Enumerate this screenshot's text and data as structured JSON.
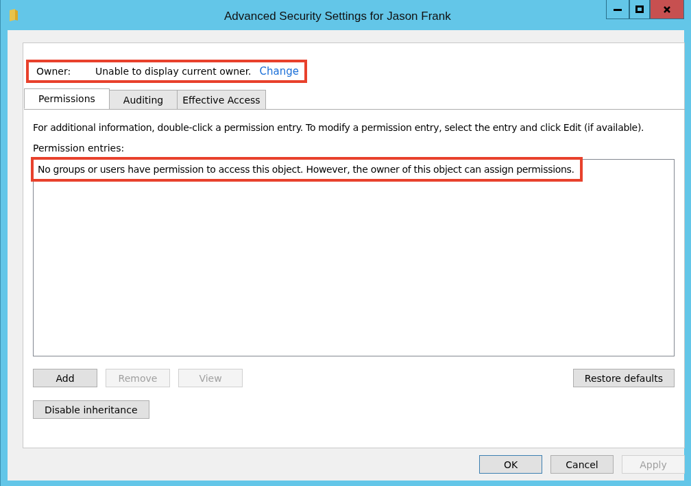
{
  "window": {
    "title": "Advanced Security Settings for Jason Frank"
  },
  "owner": {
    "label": "Owner:",
    "value": "Unable to display current owner.",
    "link": "Change",
    "highlighted": true
  },
  "tabs": [
    {
      "label": "Permissions",
      "selected": true
    },
    {
      "label": "Auditing",
      "selected": false
    },
    {
      "label": "Effective Access",
      "selected": false
    }
  ],
  "info": "For additional information, double-click a permission entry. To modify a permission entry, select the entry and click Edit (if available).",
  "entries": {
    "label": "Permission entries:",
    "message": "No groups or users have permission to access this object. However, the owner of this object can assign permissions.",
    "highlighted": true
  },
  "entry_buttons": [
    {
      "label": "Add",
      "disabled": false
    },
    {
      "label": "Remove",
      "disabled": true
    },
    {
      "label": "View",
      "disabled": true
    }
  ],
  "restore_button": {
    "label": "Restore defaults",
    "disabled": false
  },
  "inheritance_button": {
    "label": "Disable inheritance",
    "disabled": false
  },
  "dialog_buttons": [
    {
      "label": "OK",
      "disabled": false,
      "default": true
    },
    {
      "label": "Cancel",
      "disabled": false,
      "default": false
    },
    {
      "label": "Apply",
      "disabled": true,
      "default": false
    }
  ]
}
